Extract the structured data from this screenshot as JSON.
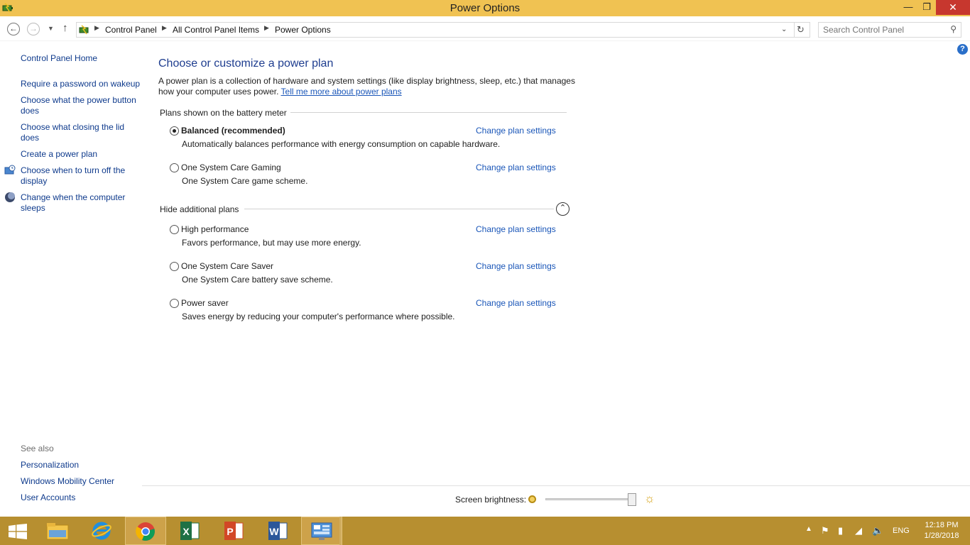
{
  "window": {
    "title": "Power Options"
  },
  "nav": {
    "breadcrumbs": [
      "Control Panel",
      "All Control Panel Items",
      "Power Options"
    ],
    "search_placeholder": "Search Control Panel"
  },
  "sidebar": {
    "home": "Control Panel Home",
    "links": [
      {
        "label": "Require a password on wakeup"
      },
      {
        "label": "Choose what the power button does"
      },
      {
        "label": "Choose what closing the lid does"
      },
      {
        "label": "Create a power plan"
      },
      {
        "label": "Choose when to turn off the display"
      },
      {
        "label": "Change when the computer sleeps"
      }
    ],
    "see_also_title": "See also",
    "see_also": [
      "Personalization",
      "Windows Mobility Center",
      "User Accounts"
    ]
  },
  "main": {
    "heading": "Choose or customize a power plan",
    "description": "A power plan is a collection of hardware and system settings (like display brightness, sleep, etc.) that manages how your computer uses power.",
    "learn_more": "Tell me more about power plans",
    "battery_section": "Plans shown on the battery meter",
    "additional_section": "Hide additional plans",
    "change_label": "Change plan settings",
    "plans": [
      {
        "name": "Balanced (recommended)",
        "desc": "Automatically balances performance with energy consumption on capable hardware.",
        "selected": true
      },
      {
        "name": "One System Care Gaming",
        "desc": "One System Care game scheme.",
        "selected": false
      },
      {
        "name": "High performance",
        "desc": "Favors performance, but may use more energy.",
        "selected": false
      },
      {
        "name": "One System Care Saver",
        "desc": "One System Care battery save scheme.",
        "selected": false
      },
      {
        "name": "Power saver",
        "desc": "Saves energy by reducing your computer's performance where possible.",
        "selected": false
      }
    ]
  },
  "brightness": {
    "label": "Screen brightness:",
    "level": 1.0
  },
  "taskbar": {
    "lang": "ENG",
    "time": "12:18 PM",
    "date": "1/28/2018"
  }
}
